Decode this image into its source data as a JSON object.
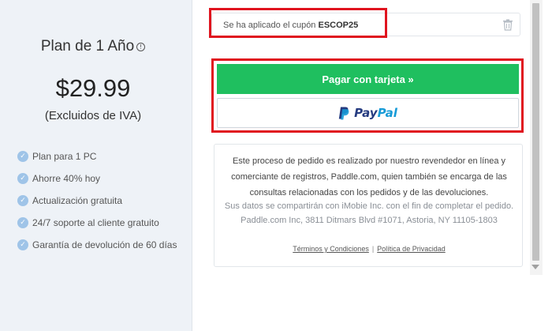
{
  "plan": {
    "title": "Plan de 1 Año",
    "info_icon": "info-icon",
    "price": "$29.99",
    "vat_note": "(Excluidos de IVA)",
    "features": [
      "Plan para 1 PC",
      "Ahorre 40% hoy",
      "Actualización gratuita",
      "24/7 soporte al cliente gratuito",
      "Garantía de devolución de 60 días"
    ]
  },
  "coupon": {
    "prefix": "Se ha aplicado el cupón",
    "code": "ESCOP25",
    "remove_icon": "trash-icon"
  },
  "payment": {
    "card_button": "Pagar con tarjeta »",
    "paypal_pay": "Pay",
    "paypal_pal": "Pal"
  },
  "info": {
    "main_text": "Este proceso de pedido es realizado por nuestro revendedor en línea y comerciante de registros, Paddle.com, quien también se encarga de las consultas relacionadas con los pedidos y de las devoluciones.",
    "sub_text": "Sus datos se compartirán con iMobie Inc. con el fin de completar el pedido. Paddle.com Inc, 3811 Ditmars Blvd #1071, Astoria, NY 11105-1803",
    "terms_link": "Términos y Condiciones",
    "separator": "|",
    "privacy_link": "Política de Privacidad"
  },
  "colors": {
    "left_panel_bg": "#eef2f7",
    "pay_button": "#1fbf5f",
    "highlight_frame": "#e0141f",
    "paypal_dark": "#253b80",
    "paypal_light": "#179bd7"
  }
}
